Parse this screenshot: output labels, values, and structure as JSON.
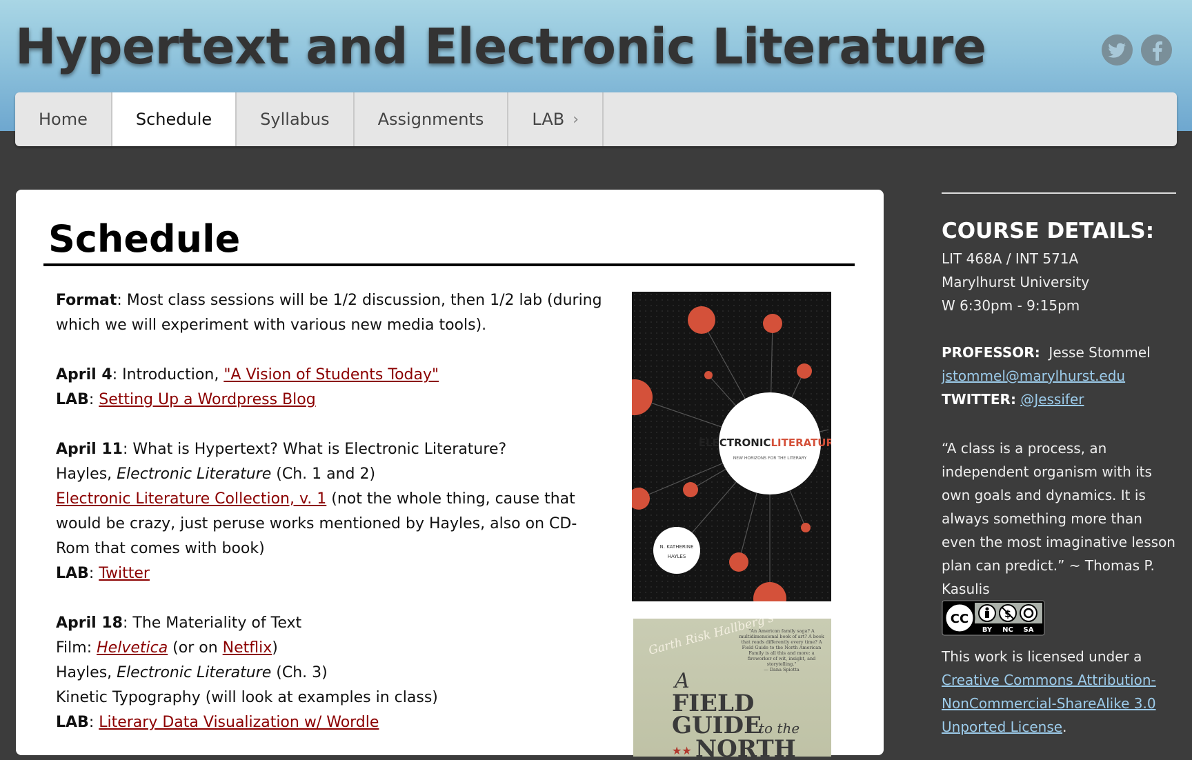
{
  "site": {
    "title": "Hypertext and Electronic Literature",
    "social": {
      "twitter_icon": "twitter-icon",
      "facebook_icon": "facebook-icon"
    }
  },
  "nav": {
    "items": [
      {
        "label": "Home"
      },
      {
        "label": "Schedule",
        "active": true
      },
      {
        "label": "Syllabus"
      },
      {
        "label": "Assignments"
      },
      {
        "label": "LAB",
        "has_submenu": true,
        "arrow": "›"
      }
    ]
  },
  "main": {
    "title": "Schedule",
    "format": {
      "label": "Format",
      "text": ": Most class sessions will be 1/2 discussion, then 1/2 lab (during which we will experiment with various new media tools)."
    },
    "weeks": [
      {
        "date": "April 4",
        "intro": ": Introduction, ",
        "link": "\"A Vision of Students Today\"",
        "lab_label": "LAB",
        "lab_sep": ": ",
        "lab_link": "Setting Up a Wordpress Blog"
      },
      {
        "date": "April 11",
        "intro": ": What is Hypertext? What is Electronic Literature?",
        "reading_author": "Hayles, ",
        "reading_title": "Electronic Literature",
        "reading_chapters": " (Ch. 1 and 2)",
        "collection_link": "Electronic Literature Collection, v. 1",
        "collection_note": " (not the whole thing, cause that would be crazy, just peruse works mentioned by Hayles, also on CD-Rom that comes with book)",
        "lab_label": "LAB",
        "lab_sep": ": ",
        "lab_link": "Twitter"
      },
      {
        "date": "April 18",
        "intro": ": The Materiality of Text",
        "film_label": "Film: ",
        "film_link": "Helvetica",
        "film_mid": " (or on ",
        "film_alt_link": "Netflix",
        "film_end": ")",
        "reading_author": "Hayles, ",
        "reading_title": "Electronic Literature",
        "reading_chapters": " (Ch. 3)",
        "extra": "Kinetic Typography (will look at examples in class)",
        "lab_label": "LAB",
        "lab_sep": ": ",
        "lab_link": "Literary Data Visualization w/ Wordle"
      }
    ],
    "book1": {
      "title_a": "ELECTRONIC",
      "title_b": "LITERATURE",
      "subtitle": "NEW HORIZONS FOR THE LITERARY",
      "author_a": "N. KATHERINE",
      "author_b": "HAYLES"
    },
    "book2": {
      "script": "Garth Risk Hallberg's",
      "line1": "A",
      "line2": "FIELD",
      "line3": "GUIDE",
      "line3b": "to the",
      "line4": "NORTH",
      "blurb": "\"An American family saga? A multidimensional book of art? A book that reads differently every time? A Field Guide to the North American Family is all this and more: a fireworker of wit, insight, and storytelling.\"",
      "blurb_credit": "— Dana Spiotta"
    }
  },
  "sidebar": {
    "heading": "COURSE DETAILS:",
    "course_code": "LIT 468A / INT 571A",
    "university": "Marylhurst University",
    "time": "W 6:30pm - 9:15pm",
    "professor_label": "PROFESSOR:",
    "professor_name": "Jesse Stommel",
    "email": "jstommel@marylhurst.edu",
    "twitter_label": "TWITTER:",
    "twitter_handle": "@Jessifer",
    "quote": "“A class is a process, an independent organism with its own goals and dynamics. It is always something more than even the most imaginative lesson plan can predict.” ~ Thomas P. Kasulis",
    "license_badge": {
      "cc": "CC",
      "by": "BY",
      "nc": "NC",
      "sa": "SA"
    },
    "license_text": "This work is licensed under a ",
    "license_link": "Creative Commons Attribution-NonCommercial-ShareAlike 3.0 Unported License",
    "license_end": "."
  },
  "colors": {
    "header_top": "#a9d6e5",
    "header_bottom": "#6ea7cf",
    "background": "#3c3c3c",
    "link": "#8b0000",
    "sidebar_link": "#9ccbea"
  }
}
